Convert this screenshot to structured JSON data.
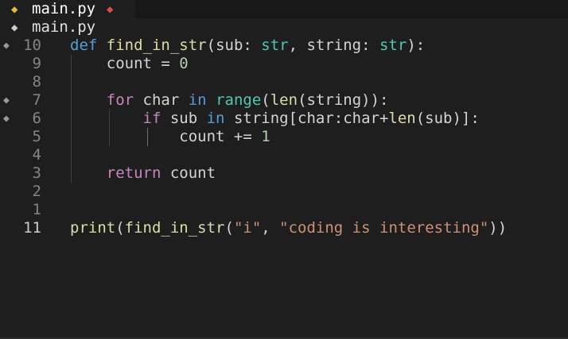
{
  "tab": {
    "icon": "python-file-icon",
    "label": "main.py",
    "dirty_icon": "modified-diamond-icon"
  },
  "breadcrumb": {
    "icon": "python-file-icon",
    "label": "main.py"
  },
  "editor": {
    "lines": [
      {
        "number": "10",
        "glyph": "◆",
        "tokens": [
          {
            "t": "def",
            "c": "kw"
          },
          {
            "t": " ",
            "c": "var"
          },
          {
            "t": "find_in_str",
            "c": "fn"
          },
          {
            "t": "(sub: ",
            "c": "var"
          },
          {
            "t": "str",
            "c": "ty"
          },
          {
            "t": ", string: ",
            "c": "var"
          },
          {
            "t": "str",
            "c": "ty"
          },
          {
            "t": "):",
            "c": "var"
          }
        ]
      },
      {
        "number": "9",
        "glyph": "",
        "tokens": [
          {
            "t": "    count = ",
            "c": "var"
          },
          {
            "t": "0",
            "c": "num"
          }
        ]
      },
      {
        "number": "8",
        "glyph": "",
        "tokens": []
      },
      {
        "number": "7",
        "glyph": "◆",
        "tokens": [
          {
            "t": "    ",
            "c": "var"
          },
          {
            "t": "for",
            "c": "ctl"
          },
          {
            "t": " char ",
            "c": "var"
          },
          {
            "t": "in",
            "c": "kw"
          },
          {
            "t": " ",
            "c": "var"
          },
          {
            "t": "range",
            "c": "ty"
          },
          {
            "t": "(",
            "c": "var"
          },
          {
            "t": "len",
            "c": "fn"
          },
          {
            "t": "(string)):",
            "c": "var"
          }
        ]
      },
      {
        "number": "6",
        "glyph": "◆",
        "tokens": [
          {
            "t": "        ",
            "c": "var"
          },
          {
            "t": "if",
            "c": "ctl"
          },
          {
            "t": " sub ",
            "c": "var"
          },
          {
            "t": "in",
            "c": "kw"
          },
          {
            "t": " string[char:char+",
            "c": "var"
          },
          {
            "t": "len",
            "c": "fn"
          },
          {
            "t": "(sub)]:",
            "c": "var"
          }
        ]
      },
      {
        "number": "5",
        "glyph": "",
        "tokens": [
          {
            "t": "            count += ",
            "c": "var"
          },
          {
            "t": "1",
            "c": "num"
          }
        ]
      },
      {
        "number": "4",
        "glyph": "",
        "tokens": []
      },
      {
        "number": "3",
        "glyph": "",
        "tokens": [
          {
            "t": "    ",
            "c": "var"
          },
          {
            "t": "return",
            "c": "ctl"
          },
          {
            "t": " count",
            "c": "var"
          }
        ]
      },
      {
        "number": "2",
        "glyph": "",
        "tokens": []
      },
      {
        "number": "1",
        "glyph": "",
        "tokens": []
      },
      {
        "number": "11",
        "glyph": "",
        "current": true,
        "tokens": [
          {
            "t": "print",
            "c": "fn"
          },
          {
            "t": "(",
            "c": "var"
          },
          {
            "t": "find_in_str",
            "c": "fn"
          },
          {
            "t": "(",
            "c": "var"
          },
          {
            "t": "\"i\"",
            "c": "str"
          },
          {
            "t": ", ",
            "c": "var"
          },
          {
            "t": "\"coding is interesting\"",
            "c": "str"
          },
          {
            "t": "))",
            "c": "var"
          }
        ]
      }
    ]
  },
  "colors": {
    "background": "#1e1e1e",
    "keyword": "#569cd6",
    "control": "#c586c0",
    "function": "#dcdcaa",
    "type": "#4ec9b0",
    "string": "#ce9178",
    "number": "#b5cea8"
  }
}
